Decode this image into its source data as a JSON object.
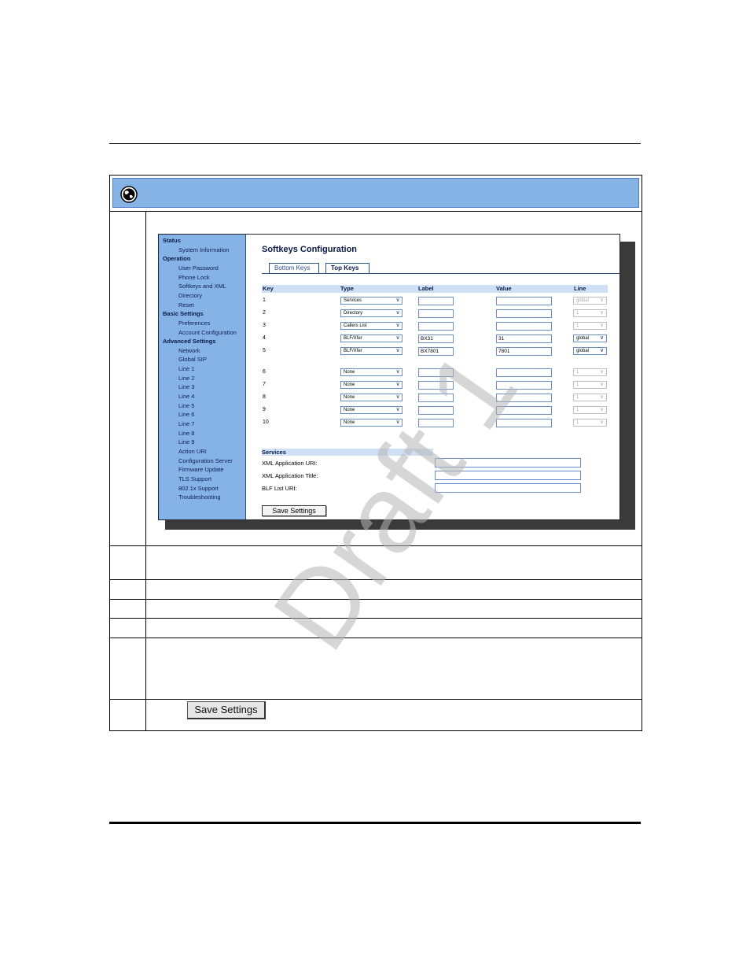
{
  "main": {
    "title": "Softkeys Configuration",
    "tabs": [
      {
        "label": "Bottom Keys",
        "active": false
      },
      {
        "label": "Top Keys",
        "active": true
      }
    ],
    "columns": {
      "key": "Key",
      "type": "Type",
      "label": "Label",
      "value": "Value",
      "line": "Line"
    },
    "rows": [
      {
        "key": "1",
        "type": "Services",
        "label": "",
        "value": "",
        "line": "global",
        "line_enabled": false
      },
      {
        "key": "2",
        "type": "Directory",
        "label": "",
        "value": "",
        "line": "1",
        "line_enabled": false
      },
      {
        "key": "3",
        "type": "Callers List",
        "label": "",
        "value": "",
        "line": "1",
        "line_enabled": false
      },
      {
        "key": "4",
        "type": "BLF/Xfer",
        "label": "BX31",
        "value": "31",
        "line": "global",
        "line_enabled": true
      },
      {
        "key": "5",
        "type": "BLF/Xfer",
        "label": "BX7801",
        "value": "7801",
        "line": "global",
        "line_enabled": true
      },
      {
        "key": "6",
        "type": "None",
        "label": "",
        "value": "",
        "line": "1",
        "line_enabled": false
      },
      {
        "key": "7",
        "type": "None",
        "label": "",
        "value": "",
        "line": "1",
        "line_enabled": false
      },
      {
        "key": "8",
        "type": "None",
        "label": "",
        "value": "",
        "line": "1",
        "line_enabled": false
      },
      {
        "key": "9",
        "type": "None",
        "label": "",
        "value": "",
        "line": "1",
        "line_enabled": false
      },
      {
        "key": "10",
        "type": "None",
        "label": "",
        "value": "",
        "line": "1",
        "line_enabled": false
      }
    ],
    "services": {
      "heading": "Services",
      "fields": [
        {
          "label": "XML Application URI:",
          "value": ""
        },
        {
          "label": "XML Application Title:",
          "value": ""
        },
        {
          "label": "BLF List URI:",
          "value": ""
        }
      ]
    },
    "save_label": "Save Settings"
  },
  "sidebar": {
    "sections": [
      {
        "heading": "Status",
        "items": [
          "System Information"
        ]
      },
      {
        "heading": "Operation",
        "items": [
          "User Password",
          "Phone Lock",
          "Softkeys and XML",
          "Directory",
          "Reset"
        ]
      },
      {
        "heading": "Basic Settings",
        "items": [
          "Preferences",
          "Account Configuration"
        ]
      },
      {
        "heading": "Advanced Settings",
        "items": [
          "Network",
          "Global SIP",
          "Line 1",
          "Line 2",
          "Line 3",
          "Line 4",
          "Line 5",
          "Line 6",
          "Line 7",
          "Line 8",
          "Line 9",
          "Action URI",
          "Configuration Server",
          "Firmware Update",
          "TLS Support",
          "802.1x Support",
          "Troubleshooting"
        ]
      }
    ]
  },
  "step_button": {
    "label": "Save Settings"
  },
  "watermark": "Draft 1",
  "icons": {
    "banner": "globe-icon",
    "dropdown": "chevron-down-icon"
  },
  "colors": {
    "banner": "#86b3e6",
    "sidebar": "#86b3e6",
    "header_bar": "#cfe0f5"
  }
}
